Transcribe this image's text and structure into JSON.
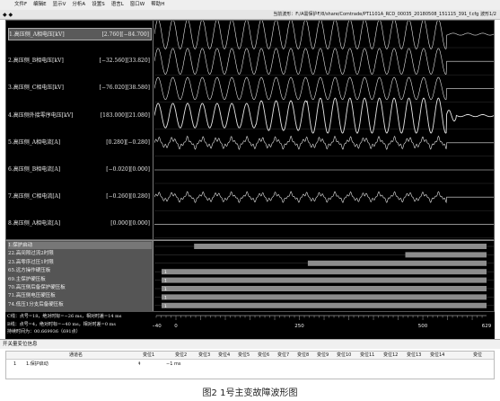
{
  "menu": [
    "文件F",
    "编辑E",
    "显示V",
    "分析A",
    "设置S",
    "语言L",
    "窗口W",
    "帮助H"
  ],
  "toolbar": {
    "icons": "◆ ◆",
    "current_file": "当前波形：F:/A需保护F/8/share/Comtrade/PT1101A_RCD_00035_20180508_151115_391_f.cfg  波形1/2"
  },
  "analog_channels": [
    {
      "label": "1.高压侧_A相电压[kV]",
      "values": "[2.760][−84.700]",
      "kind": "voltage",
      "cycles": 23,
      "amp": 0.4,
      "amp_after": 0.05
    },
    {
      "label": "2.高压侧_B相电压[kV]",
      "values": "[−32.560][33.820]",
      "kind": "voltage",
      "cycles": 23,
      "amp": 0.35,
      "amp_after": 0.0
    },
    {
      "label": "3.高压侧_C相电压[kV]",
      "values": "[−76.020][38.580]",
      "kind": "voltage",
      "cycles": 23,
      "amp": 0.3,
      "amp_after": 0.0
    },
    {
      "label": "4.高压侧外接零序电压[kV]",
      "values": "[183.000][21.080]",
      "kind": "big",
      "cycles": 23,
      "amp": 0.45,
      "amp_after": 0.05
    },
    {
      "label": "5.高压侧_A相电流[A]",
      "values": "[0.280][−0.280]",
      "kind": "noise",
      "cycles": 23,
      "amp": 0.18,
      "amp_after": 0.0
    },
    {
      "label": "6.高压侧_B相电流[A]",
      "values": "[−0.020][0.000]",
      "kind": "flat",
      "cycles": 0,
      "amp": 0,
      "amp_after": 0
    },
    {
      "label": "7.高压侧_C相电流[A]",
      "values": "[−0.260][0.280]",
      "kind": "noise",
      "cycles": 23,
      "amp": 0.15,
      "amp_after": 0.0
    },
    {
      "label": "8.高压侧_A相电流[A]",
      "values": "[0.000][0.000]",
      "kind": "flat",
      "cycles": 0,
      "amp": 0,
      "amp_after": 0
    }
  ],
  "digital_channels": [
    {
      "label": "1.保护启动",
      "state_from": 0.1,
      "state_to": 1.0
    },
    {
      "label": "22.高间隙过流2时限",
      "state_from": 0.75,
      "state_to": 1.0
    },
    {
      "label": "23.高零序过压1时限",
      "state_from": 0.45,
      "state_to": 1.0
    },
    {
      "label": "65.远方操作硬压板",
      "state_from": 0.0,
      "state_to": 1.0
    },
    {
      "label": "69.主保护硬压板",
      "state_from": 0.0,
      "state_to": 1.0
    },
    {
      "label": "70.高压侧后备保护硬压板",
      "state_from": 0.0,
      "state_to": 1.0
    },
    {
      "label": "71.高压侧电压硬压板",
      "state_from": 0.0,
      "state_to": 1.0
    },
    {
      "label": "74.低压1分支后备硬压板",
      "state_from": 0.0,
      "state_to": 1.0
    }
  ],
  "cursor_info": {
    "line1": "C线：点号=18，绝对时标=−26 ms，相对时差=14 ms",
    "line2": "B线：点号=4，绝对时标=−40 ms，相对时差=0 ms",
    "line3": "持续时间为：00.669936（691点）"
  },
  "axis": {
    "ticks": [
      "−40",
      "0",
      "250",
      "500",
      "629"
    ],
    "tick_values": [
      -40,
      0,
      250,
      500,
      629
    ],
    "min": -40,
    "max": 629
  },
  "switch_panel": {
    "title": "开关量变位信息",
    "headers": [
      "通道名",
      "变位1",
      "变位2",
      "变位3",
      "变位4",
      "变位5",
      "变位6",
      "变位7",
      "变位8",
      "变位9",
      "变位10",
      "变位11",
      "变位12",
      "变位13",
      "变位14",
      "变位"
    ],
    "row": {
      "index": "1",
      "channel": "1.保护启动",
      "mark": "↟",
      "change1": "−1 ms"
    }
  },
  "caption": "图2  1号主变故障波形图",
  "colors": {
    "wave": "#e6e6e6",
    "background": "#000000",
    "digital_bar": "#8c8c8c"
  }
}
